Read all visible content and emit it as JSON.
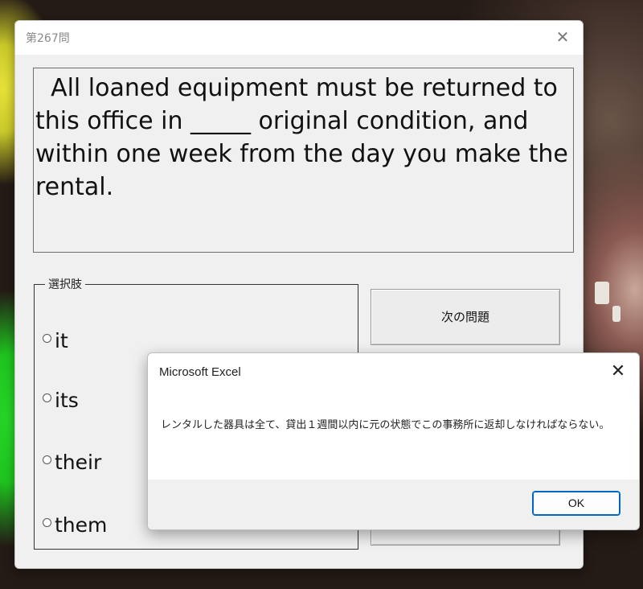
{
  "colors": {
    "dialog_bg": "#f0f0f0",
    "accent": "#0067c0",
    "title_text": "#8a8a8a"
  },
  "dialog": {
    "title": "第267問",
    "close_icon": "close-icon",
    "question": "  All loaned equipment must be returned to this office in _____ original condition, and within one week from the day you make the rental.",
    "choices_label": "選択肢",
    "choices": [
      {
        "label": "it",
        "selected": false
      },
      {
        "label": "its",
        "selected": false
      },
      {
        "label": "their",
        "selected": false
      },
      {
        "label": "them",
        "selected": false
      }
    ],
    "next_button": "次の問題"
  },
  "message_box": {
    "title": "Microsoft Excel",
    "close_icon": "close-icon",
    "message": "レンタルした器具は全て、貸出１週間以内に元の状態でこの事務所に返却しなければならない。",
    "ok_label": "OK"
  }
}
